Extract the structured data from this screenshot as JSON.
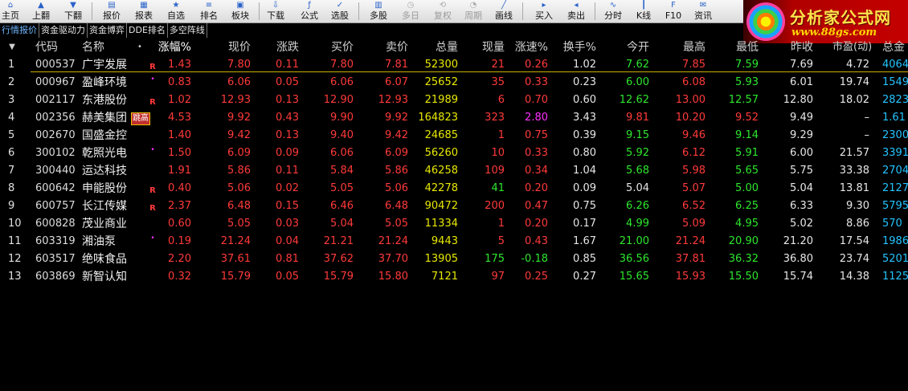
{
  "toolbar": {
    "buttons": [
      {
        "label": "主页",
        "icon": "home-icon",
        "enabled": true
      },
      {
        "label": "上翻",
        "icon": "arrow-up-icon",
        "enabled": true
      },
      {
        "label": "下翻",
        "icon": "arrow-down-icon",
        "enabled": true
      },
      {
        "label": "报价",
        "icon": "quote-icon",
        "enabled": true
      },
      {
        "label": "报表",
        "icon": "report-icon",
        "enabled": true
      },
      {
        "label": "自选",
        "icon": "star-icon",
        "enabled": true
      },
      {
        "label": "排名",
        "icon": "rank-icon",
        "enabled": true
      },
      {
        "label": "板块",
        "icon": "sector-icon",
        "enabled": true
      },
      {
        "label": "下载",
        "icon": "download-icon",
        "enabled": true
      },
      {
        "label": "公式",
        "icon": "formula-icon",
        "enabled": true
      },
      {
        "label": "选股",
        "icon": "stock-pick-icon",
        "enabled": true
      },
      {
        "label": "多股",
        "icon": "multi-stock-icon",
        "enabled": true
      },
      {
        "label": "多日",
        "icon": "multi-day-icon",
        "enabled": false
      },
      {
        "label": "复权",
        "icon": "adjust-icon",
        "enabled": false
      },
      {
        "label": "周期",
        "icon": "period-icon",
        "enabled": false
      },
      {
        "label": "画线",
        "icon": "draw-line-icon",
        "enabled": true
      },
      {
        "label": "买入",
        "icon": "buy-icon",
        "enabled": true
      },
      {
        "label": "卖出",
        "icon": "sell-icon",
        "enabled": true
      },
      {
        "label": "分时",
        "icon": "intraday-icon",
        "enabled": true
      },
      {
        "label": "K线",
        "icon": "kline-icon",
        "enabled": true
      },
      {
        "label": "F10",
        "icon": "f10-icon",
        "enabled": true
      },
      {
        "label": "资讯",
        "icon": "news-icon",
        "enabled": true
      }
    ]
  },
  "logo": {
    "title": "分析家公式网",
    "url": "www.88gs.com",
    "colors": {
      "bg": "#c40000",
      "text": "#ffe34a"
    }
  },
  "tabs": [
    {
      "label": "行情报价",
      "active": true
    },
    {
      "label": "资金驱动力",
      "active": false
    },
    {
      "label": "资金博弈",
      "active": false
    },
    {
      "label": "DDE排名",
      "active": false
    },
    {
      "label": "多空阵线",
      "active": false
    }
  ],
  "table": {
    "headers": [
      "代码",
      "名称",
      "涨幅%",
      "现价",
      "涨跌",
      "买价",
      "卖价",
      "总量",
      "现量",
      "涨速%",
      "换手%",
      "今开",
      "最高",
      "最低",
      "昨收",
      "市盈(动)",
      "总金"
    ],
    "sorted_column": "涨幅%",
    "tag_label": "跳高",
    "rows": [
      {
        "idx": "1",
        "code": "000537",
        "name": "广宇发展",
        "mark": "R",
        "chg_pct": "1.43",
        "price": "7.80",
        "change": "0.11",
        "bid": "7.80",
        "ask": "7.81",
        "volume": "52300",
        "cur_vol": "21",
        "speed": "0.26",
        "turnover": "1.02",
        "open": "7.62",
        "high": "7.85",
        "low": "7.59",
        "prev_close": "7.69",
        "pe": "4.72",
        "amount": "4064"
      },
      {
        "idx": "2",
        "code": "000967",
        "name": "盈峰环境",
        "mark": "•",
        "chg_pct": "0.83",
        "price": "6.06",
        "change": "0.05",
        "bid": "6.06",
        "ask": "6.07",
        "volume": "25652",
        "cur_vol": "35",
        "speed": "0.33",
        "turnover": "0.23",
        "open": "6.00",
        "high": "6.08",
        "low": "5.93",
        "prev_close": "6.01",
        "pe": "19.74",
        "amount": "1549"
      },
      {
        "idx": "3",
        "code": "002117",
        "name": "东港股份",
        "mark": "R",
        "chg_pct": "1.02",
        "price": "12.93",
        "change": "0.13",
        "bid": "12.90",
        "ask": "12.93",
        "volume": "21989",
        "cur_vol": "6",
        "speed": "0.70",
        "turnover": "0.60",
        "open": "12.62",
        "high": "13.00",
        "low": "12.57",
        "prev_close": "12.80",
        "pe": "18.02",
        "amount": "2823"
      },
      {
        "idx": "4",
        "code": "002356",
        "name": "赫美集团",
        "mark": "tag",
        "chg_pct": "4.53",
        "price": "9.92",
        "change": "0.43",
        "bid": "9.90",
        "ask": "9.92",
        "volume": "164823",
        "cur_vol": "323",
        "speed": "2.80",
        "turnover": "3.43",
        "open": "9.81",
        "high": "10.20",
        "low": "9.52",
        "prev_close": "9.49",
        "pe": "–",
        "amount": "1.61"
      },
      {
        "idx": "5",
        "code": "002670",
        "name": "国盛金控",
        "mark": "",
        "chg_pct": "1.40",
        "price": "9.42",
        "change": "0.13",
        "bid": "9.40",
        "ask": "9.42",
        "volume": "24685",
        "cur_vol": "1",
        "speed": "0.75",
        "turnover": "0.39",
        "open": "9.15",
        "high": "9.46",
        "low": "9.14",
        "prev_close": "9.29",
        "pe": "–",
        "amount": "2300"
      },
      {
        "idx": "6",
        "code": "300102",
        "name": "乾照光电",
        "mark": "•",
        "chg_pct": "1.50",
        "price": "6.09",
        "change": "0.09",
        "bid": "6.06",
        "ask": "6.09",
        "volume": "56260",
        "cur_vol": "10",
        "speed": "0.33",
        "turnover": "0.80",
        "open": "5.92",
        "high": "6.12",
        "low": "5.91",
        "prev_close": "6.00",
        "pe": "21.57",
        "amount": "3391"
      },
      {
        "idx": "7",
        "code": "300440",
        "name": "运达科技",
        "mark": "",
        "chg_pct": "1.91",
        "price": "5.86",
        "change": "0.11",
        "bid": "5.84",
        "ask": "5.86",
        "volume": "46258",
        "cur_vol": "109",
        "speed": "0.34",
        "turnover": "1.04",
        "open": "5.68",
        "high": "5.98",
        "low": "5.65",
        "prev_close": "5.75",
        "pe": "33.38",
        "amount": "2704"
      },
      {
        "idx": "8",
        "code": "600642",
        "name": "申能股份",
        "mark": "R",
        "chg_pct": "0.40",
        "price": "5.06",
        "change": "0.02",
        "bid": "5.05",
        "ask": "5.06",
        "volume": "42278",
        "cur_vol": "41",
        "speed": "0.20",
        "turnover": "0.09",
        "open": "5.04",
        "high": "5.07",
        "low": "5.00",
        "prev_close": "5.04",
        "pe": "13.81",
        "amount": "2127"
      },
      {
        "idx": "9",
        "code": "600757",
        "name": "长江传媒",
        "mark": "R",
        "chg_pct": "2.37",
        "price": "6.48",
        "change": "0.15",
        "bid": "6.46",
        "ask": "6.48",
        "volume": "90472",
        "cur_vol": "200",
        "speed": "0.47",
        "turnover": "0.75",
        "open": "6.26",
        "high": "6.52",
        "low": "6.25",
        "prev_close": "6.33",
        "pe": "9.30",
        "amount": "5795"
      },
      {
        "idx": "10",
        "code": "600828",
        "name": "茂业商业",
        "mark": "",
        "chg_pct": "0.60",
        "price": "5.05",
        "change": "0.03",
        "bid": "5.04",
        "ask": "5.05",
        "volume": "11334",
        "cur_vol": "1",
        "speed": "0.20",
        "turnover": "0.17",
        "open": "4.99",
        "high": "5.09",
        "low": "4.95",
        "prev_close": "5.02",
        "pe": "8.86",
        "amount": "570"
      },
      {
        "idx": "11",
        "code": "603319",
        "name": "湘油泵",
        "mark": "•",
        "chg_pct": "0.19",
        "price": "21.24",
        "change": "0.04",
        "bid": "21.21",
        "ask": "21.24",
        "volume": "9443",
        "cur_vol": "5",
        "speed": "0.43",
        "turnover": "1.67",
        "open": "21.00",
        "high": "21.24",
        "low": "20.90",
        "prev_close": "21.20",
        "pe": "17.54",
        "amount": "1986"
      },
      {
        "idx": "12",
        "code": "603517",
        "name": "绝味食品",
        "mark": "",
        "chg_pct": "2.20",
        "price": "37.61",
        "change": "0.81",
        "bid": "37.62",
        "ask": "37.70",
        "volume": "13905",
        "cur_vol": "175",
        "speed": "-0.18",
        "turnover": "0.85",
        "open": "36.56",
        "high": "37.81",
        "low": "36.32",
        "prev_close": "36.80",
        "pe": "23.74",
        "amount": "5201"
      },
      {
        "idx": "13",
        "code": "603869",
        "name": "新智认知",
        "mark": "",
        "chg_pct": "0.32",
        "price": "15.79",
        "change": "0.05",
        "bid": "15.79",
        "ask": "15.80",
        "volume": "7121",
        "cur_vol": "97",
        "speed": "0.25",
        "turnover": "0.27",
        "open": "15.65",
        "high": "15.93",
        "low": "15.50",
        "prev_close": "15.74",
        "pe": "14.38",
        "amount": "1125"
      }
    ]
  },
  "colors": {
    "up": "#ff3a3a",
    "down": "#2ee62e",
    "volume": "#e8e800",
    "accent": "#ff30ff",
    "amount": "#25c4ff",
    "background": "#000000"
  }
}
